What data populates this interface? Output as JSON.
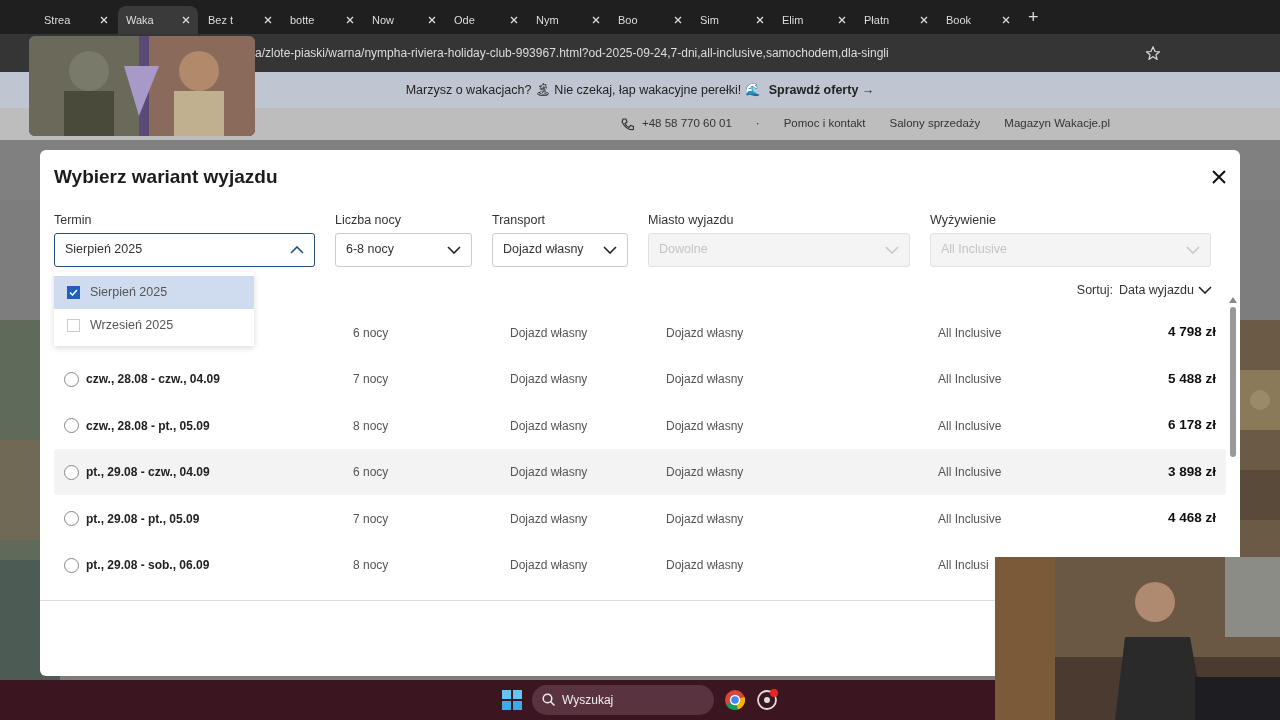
{
  "browser": {
    "tabs": [
      {
        "title": "Strea",
        "selected": false
      },
      {
        "title": "Waka",
        "selected": true
      },
      {
        "title": "Bez t",
        "selected": false
      },
      {
        "title": "botte",
        "selected": false
      },
      {
        "title": "Now",
        "selected": false
      },
      {
        "title": "Ode",
        "selected": false
      },
      {
        "title": "Nym",
        "selected": false
      },
      {
        "title": "Boo",
        "selected": false
      },
      {
        "title": "Sim",
        "selected": false
      },
      {
        "title": "Elim",
        "selected": false
      },
      {
        "title": "Płatn",
        "selected": false
      },
      {
        "title": "Book",
        "selected": false
      }
    ],
    "new_tab": "+",
    "url": "a/zlote-piaski/warna/nympha-riviera-holiday-club-993967.html?od-2025-09-24,7-dni,all-inclusive,samochodem,dla-singli"
  },
  "site": {
    "promo": {
      "text": "Marzysz o wakacjach? 🏝 Nie czekaj, łap wakacyjne perełki! 🌊",
      "link": "Sprawdź oferty →"
    },
    "phone": "+48 58 770 60 01",
    "separator": "·",
    "nav": [
      "Pomoc i kontakt",
      "Salony sprzedaży",
      "Magazyn Wakacje.pl"
    ]
  },
  "modal": {
    "title": "Wybierz wariant wyjazdu",
    "filters": [
      {
        "label": "Termin",
        "value": "Sierpień 2025",
        "open": true,
        "disabled": false
      },
      {
        "label": "Liczba nocy",
        "value": "6-8 nocy",
        "open": false,
        "disabled": false
      },
      {
        "label": "Transport",
        "value": "Dojazd własny",
        "open": false,
        "disabled": false
      },
      {
        "label": "Miasto wyjazdu",
        "value": "Dowolne",
        "open": false,
        "disabled": true
      },
      {
        "label": "Wyżywienie",
        "value": "All Inclusive",
        "open": false,
        "disabled": true
      }
    ],
    "dropdown": [
      {
        "label": "Sierpień 2025",
        "checked": true
      },
      {
        "label": "Wrzesień 2025",
        "checked": false
      }
    ],
    "sort": {
      "label": "Sortuj:",
      "value": "Data wyjazdu"
    },
    "rows": [
      {
        "nights": "6 nocy",
        "transport": "Dojazd własny",
        "city": "Dojazd własny",
        "board": "All Inclusive",
        "price": "4 798 zł",
        "hover": false
      },
      {
        "dates": "czw., 28.08 - czw., 04.09",
        "nights": "7 nocy",
        "transport": "Dojazd własny",
        "city": "Dojazd własny",
        "board": "All Inclusive",
        "price": "5 488 zł",
        "selected": false,
        "hover": false
      },
      {
        "dates": "czw., 28.08 - pt., 05.09",
        "nights": "8 nocy",
        "transport": "Dojazd własny",
        "city": "Dojazd własny",
        "board": "All Inclusive",
        "price": "6 178 zł",
        "selected": false,
        "hover": false
      },
      {
        "dates": "pt., 29.08 - czw., 04.09",
        "nights": "6 nocy",
        "transport": "Dojazd własny",
        "city": "Dojazd własny",
        "board": "All Inclusive",
        "price": "3 898 zł",
        "selected": false,
        "hover": true
      },
      {
        "dates": "pt., 29.08 - pt., 05.09",
        "nights": "7 nocy",
        "transport": "Dojazd własny",
        "city": "Dojazd własny",
        "board": "All Inclusive",
        "price": "4 468 zł",
        "selected": false,
        "hover": false
      },
      {
        "dates": "pt., 29.08 - sob., 06.09",
        "nights": "8 nocy",
        "transport": "Dojazd własny",
        "city": "Dojazd własny",
        "board": "All Inclusi",
        "selected": false,
        "hover": false
      }
    ]
  },
  "taskbar": {
    "search_placeholder": "Wyszukaj"
  }
}
